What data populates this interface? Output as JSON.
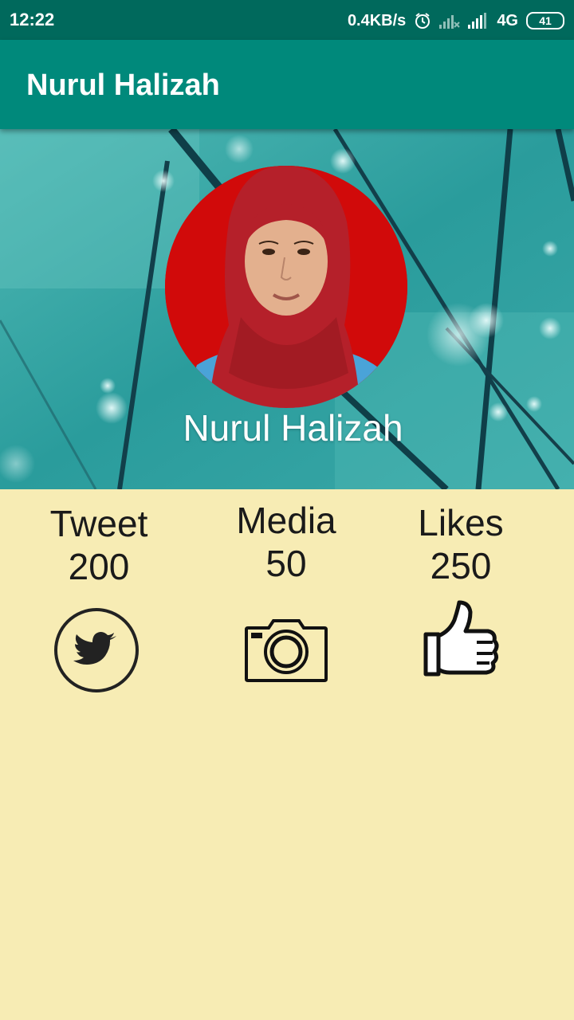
{
  "status_bar": {
    "time": "12:22",
    "network_speed": "0.4KB/s",
    "network_type": "4G",
    "battery": "41",
    "icons": [
      "alarm-icon",
      "signal-weak-icon",
      "signal-icon",
      "battery-icon"
    ]
  },
  "app_bar": {
    "title": "Nurul Halizah"
  },
  "profile": {
    "name": "Nurul Halizah"
  },
  "stats": [
    {
      "label": "Tweet",
      "value": "200",
      "icon": "twitter-bird-icon"
    },
    {
      "label": "Media",
      "value": "50",
      "icon": "camera-icon"
    },
    {
      "label": "Likes",
      "value": "250",
      "icon": "thumbs-up-icon"
    }
  ],
  "colors": {
    "status_bar": "#00695c",
    "app_bar": "#00897b",
    "content_bg": "#f7ecb4",
    "avatar_bg": "#d10a0a"
  }
}
